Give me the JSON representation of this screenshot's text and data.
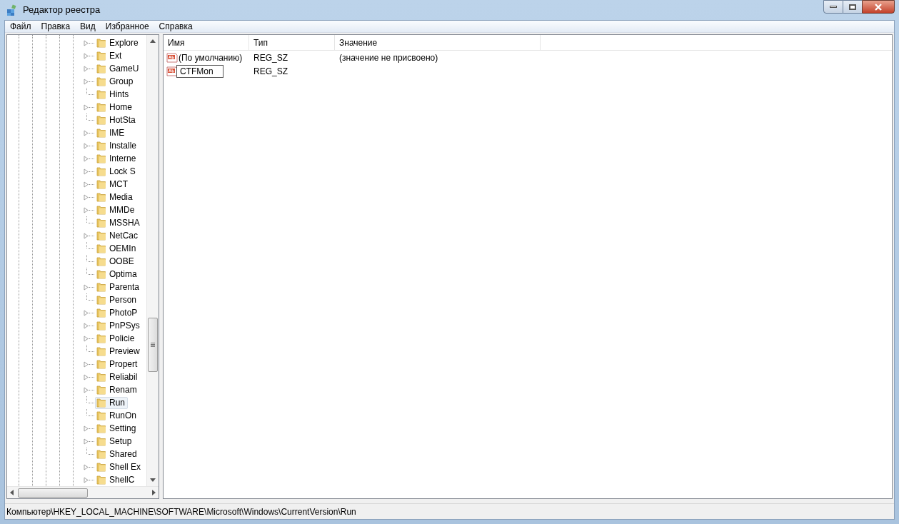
{
  "window": {
    "title": "Редактор реестра"
  },
  "menu": [
    "Файл",
    "Правка",
    "Вид",
    "Избранное",
    "Справка"
  ],
  "tree": [
    {
      "label": "Explore",
      "expandable": true,
      "selected": false
    },
    {
      "label": "Ext",
      "expandable": true,
      "selected": false
    },
    {
      "label": "GameU",
      "expandable": true,
      "selected": false
    },
    {
      "label": "Group",
      "expandable": true,
      "selected": false
    },
    {
      "label": "Hints",
      "expandable": false,
      "selected": false
    },
    {
      "label": "Home",
      "expandable": true,
      "selected": false
    },
    {
      "label": "HotSta",
      "expandable": false,
      "selected": false
    },
    {
      "label": "IME",
      "expandable": true,
      "selected": false
    },
    {
      "label": "Installe",
      "expandable": true,
      "selected": false
    },
    {
      "label": "Interne",
      "expandable": true,
      "selected": false
    },
    {
      "label": "Lock S",
      "expandable": true,
      "selected": false
    },
    {
      "label": "MCT",
      "expandable": true,
      "selected": false
    },
    {
      "label": "Media",
      "expandable": true,
      "selected": false
    },
    {
      "label": "MMDe",
      "expandable": true,
      "selected": false
    },
    {
      "label": "MSSHA",
      "expandable": false,
      "selected": false
    },
    {
      "label": "NetCac",
      "expandable": true,
      "selected": false
    },
    {
      "label": "OEMIn",
      "expandable": false,
      "selected": false
    },
    {
      "label": "OOBE",
      "expandable": false,
      "selected": false
    },
    {
      "label": "Optima",
      "expandable": false,
      "selected": false
    },
    {
      "label": "Parenta",
      "expandable": true,
      "selected": false
    },
    {
      "label": "Person",
      "expandable": false,
      "selected": false
    },
    {
      "label": "PhotoP",
      "expandable": true,
      "selected": false
    },
    {
      "label": "PnPSys",
      "expandable": true,
      "selected": false
    },
    {
      "label": "Policie",
      "expandable": true,
      "selected": false
    },
    {
      "label": "Preview",
      "expandable": false,
      "selected": false
    },
    {
      "label": "Propert",
      "expandable": true,
      "selected": false
    },
    {
      "label": "Reliabil",
      "expandable": true,
      "selected": false
    },
    {
      "label": "Renam",
      "expandable": true,
      "selected": false
    },
    {
      "label": "Run",
      "expandable": false,
      "selected": true
    },
    {
      "label": "RunOn",
      "expandable": false,
      "selected": false
    },
    {
      "label": "Setting",
      "expandable": true,
      "selected": false
    },
    {
      "label": "Setup",
      "expandable": true,
      "selected": false
    },
    {
      "label": "Shared",
      "expandable": false,
      "selected": false
    },
    {
      "label": "Shell Ex",
      "expandable": true,
      "selected": false
    },
    {
      "label": "ShellC",
      "expandable": true,
      "selected": false
    }
  ],
  "table": {
    "columns": [
      "Имя",
      "Тип",
      "Значение"
    ],
    "rows": [
      {
        "name": "(По умолчанию)",
        "type": "REG_SZ",
        "value": "(значение не присвоено)",
        "editing": false
      },
      {
        "name": "CTFMon",
        "type": "REG_SZ",
        "value": "",
        "editing": true
      }
    ]
  },
  "status_bar": "Компьютер\\HKEY_LOCAL_MACHINE\\SOFTWARE\\Microsoft\\Windows\\CurrentVersion\\Run"
}
